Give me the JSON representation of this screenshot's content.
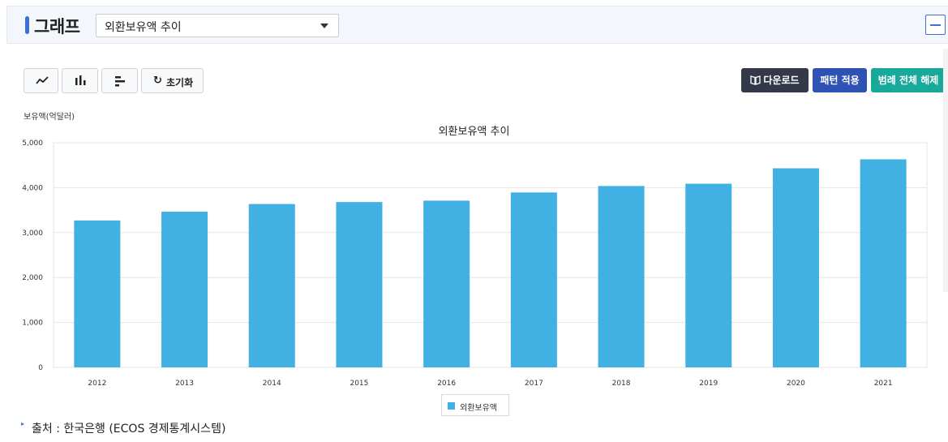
{
  "header": {
    "title": "그래프",
    "select_value": "외환보유액 추이"
  },
  "toolbar": {
    "chart_type_buttons": [
      "line-chart-icon",
      "bar-chart-icon",
      "horizontal-bar-chart-icon"
    ],
    "reset_label": "초기화",
    "download_label": "다운로드",
    "pattern_label": "패턴 적용",
    "legend_clear_label": "범례 전체 해제"
  },
  "colors": {
    "bar": "#41b0e3",
    "accent": "#3d6fd8",
    "download_bg": "#34394a",
    "pattern_bg": "#2f53b5",
    "legend_clear_bg": "#18a99a"
  },
  "chart_data": {
    "type": "bar",
    "title": "외환보유액 추이",
    "ylabel": "보유액(억달러)",
    "xlabel": "",
    "categories": [
      "2012",
      "2013",
      "2014",
      "2015",
      "2016",
      "2017",
      "2018",
      "2019",
      "2020",
      "2021"
    ],
    "series": [
      {
        "name": "외환보유액",
        "values": [
          3270,
          3465,
          3636,
          3680,
          3711,
          3893,
          4037,
          4088,
          4431,
          4631
        ]
      }
    ],
    "ylim": [
      0,
      5000
    ],
    "yticks": [
      "0",
      "1,000",
      "2,000",
      "3,000",
      "4,000",
      "5,000"
    ],
    "grid": true,
    "legend_position": "bottom"
  },
  "legend": {
    "label": "외환보유액"
  },
  "source": {
    "text": "출처 : 한국은행 (ECOS 경제통계시스템)"
  }
}
